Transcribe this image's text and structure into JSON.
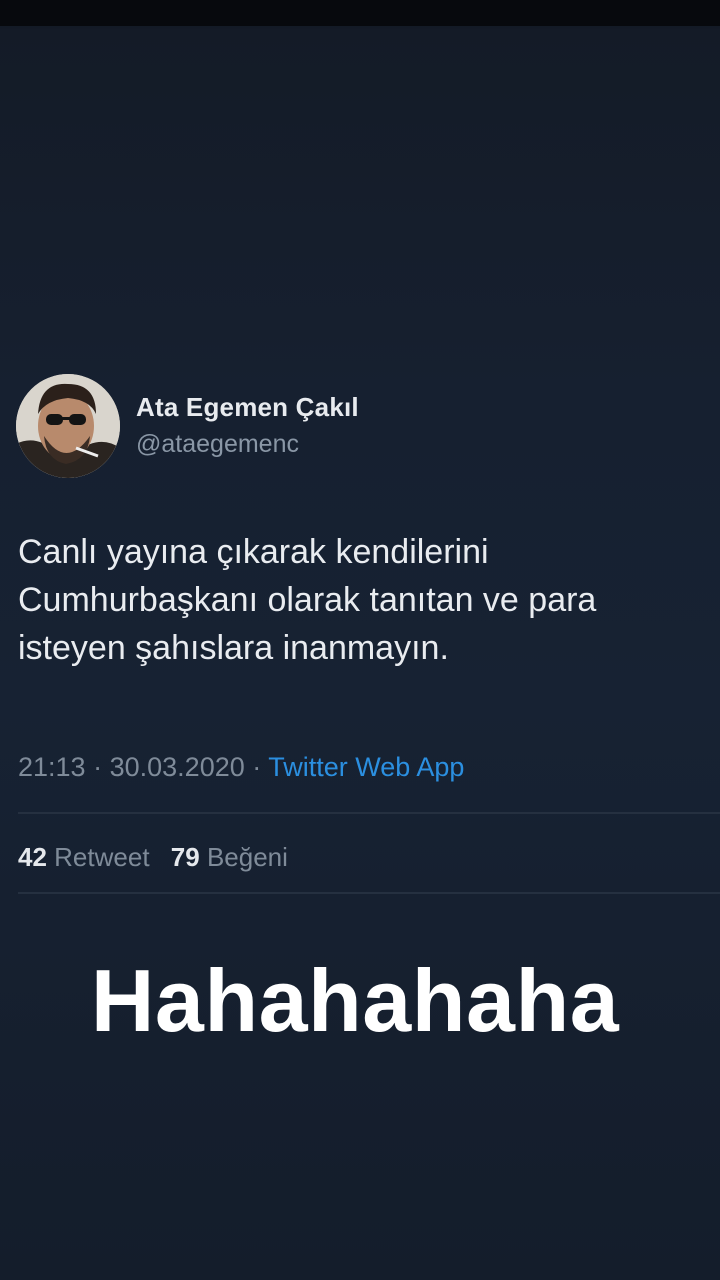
{
  "tweet": {
    "author": {
      "name": "Ata Egemen Çakıl",
      "handle": "@ataegemenc"
    },
    "text": "Canlı yayına çıkarak kendilerini\nCumhurbaşkanı olarak tanıtan ve para\nisteyen şahıslara inanmayın.",
    "time": "21:13",
    "date": "30.03.2020",
    "separator": "·",
    "source": "Twitter Web App",
    "stats": {
      "retweets": "42",
      "retweets_label": "Retweet",
      "likes": "79",
      "likes_label": "Beğeni"
    }
  },
  "caption": "Hahahahaha",
  "colors": {
    "background": "#162030",
    "link_blue": "#2b8fe0",
    "text_primary": "#e9ecf0",
    "text_secondary": "#7f8b99"
  }
}
